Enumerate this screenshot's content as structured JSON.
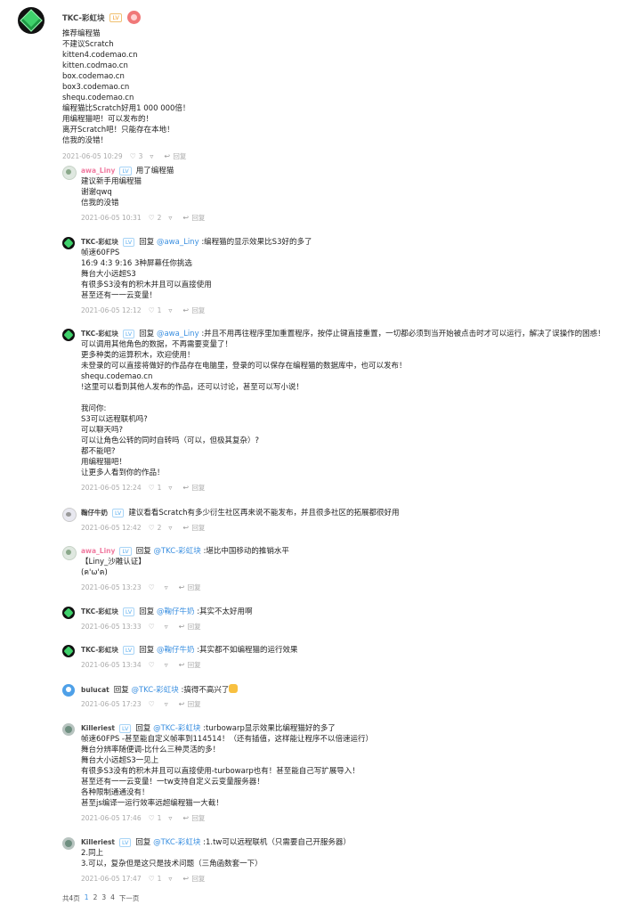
{
  "post": {
    "author": "TKC-彩虹块",
    "badge": "LV",
    "lines": [
      "推荐编程猫",
      "不建议Scratch",
      "kitten4.codemao.cn",
      "kitten.codmao.cn",
      "box.codemao.cn",
      "box3.codemao.cn",
      "shequ.codemao.cn",
      "编程猫比Scratch好用1 000 000倍！",
      "用编程猫吧！可以发布的！",
      "离开Scratch吧！只能存在本地！",
      "信我的没错！"
    ],
    "time": "2021-06-05 10:29",
    "likes": "3",
    "reply_label": "回复"
  },
  "replies": [
    {
      "name": "awa_Liny",
      "name_style": "pink",
      "avatar": "pink",
      "badge": "LV",
      "reply_prefix": "",
      "at": "",
      "head_text": "用了编程猫",
      "lines": [
        "建议新手用编程猫",
        "谢谢qwq",
        "信我的没错"
      ],
      "time": "2021-06-05 10:31",
      "likes": "2"
    },
    {
      "name": "TKC-彩虹块",
      "name_style": "",
      "avatar": "green",
      "badge": "LV",
      "reply_prefix": "回复",
      "at": "@awa_Liny",
      "head_text": ":编程猫的显示效果比S3好的多了",
      "lines": [
        "帧速60FPS",
        "16:9 4:3 9:16 3种屏幕任你挑选",
        "舞台大小远超S3",
        "有很多S3没有的积木并且可以直接使用",
        "甚至还有一一云变量！"
      ],
      "time": "2021-06-05 12:12",
      "likes": "1"
    },
    {
      "name": "TKC-彩虹块",
      "name_style": "",
      "avatar": "green",
      "badge": "LV",
      "reply_prefix": "回复",
      "at": "@awa_Liny",
      "head_text": ":并且不用再往程序里加重置程序，按停止键直接重置，一切都必须到当开始被点击时才可以运行，解决了误操作的困惑！",
      "lines": [
        "可以调用其他角色的数据，不再需要变量了！",
        "更多种类的运算积木，欢迎使用！",
        "未登录的可以直接将做好的作品存在电脑里，登录的可以保存在编程猫的数据库中，也可以发布！",
        "shequ.codemao.cn",
        "!这里可以看到其他人发布的作品，还可以讨论，甚至可以写小说！",
        "",
        "我问你:",
        "S3可以远程联机吗?",
        "可以聊天吗?",
        "可以让角色公转的同时自转吗（可以，但极其复杂）?",
        "都不能吧?",
        "用编程猫吧！",
        "让更多人看到你的作品！"
      ],
      "time": "2021-06-05 12:24",
      "likes": "1"
    },
    {
      "name": "鞠仔牛奶",
      "name_style": "",
      "avatar": "cat",
      "badge": "LV",
      "reply_prefix": "",
      "at": "",
      "head_text": "建议看看Scratch有多少衍生社区再来说不能发布，并且很多社区的拓展都很好用",
      "lines": [],
      "time": "2021-06-05 12:42",
      "likes": "2"
    },
    {
      "name": "awa_Liny",
      "name_style": "pink",
      "avatar": "pink",
      "badge": "LV",
      "reply_prefix": "回复",
      "at": "@TKC-彩虹块",
      "head_text": ":堪比中国移动的推销水平",
      "lines": [
        "【Liny_沙雕认证】",
        "(ฅ'ω'ฅ)"
      ],
      "time": "2021-06-05 13:23",
      "likes": ""
    },
    {
      "name": "TKC-彩虹块",
      "name_style": "",
      "avatar": "green",
      "badge": "LV",
      "reply_prefix": "回复",
      "at": "@鞠仔牛奶",
      "head_text": ":其实不太好用啊",
      "lines": [],
      "time": "2021-06-05 13:33",
      "likes": ""
    },
    {
      "name": "TKC-彩虹块",
      "name_style": "",
      "avatar": "green",
      "badge": "LV",
      "reply_prefix": "回复",
      "at": "@鞠仔牛奶",
      "head_text": ":其实都不如编程猫的运行效果",
      "lines": [],
      "time": "2021-06-05 13:34",
      "likes": ""
    },
    {
      "name": "bulucat",
      "name_style": "",
      "avatar": "blue",
      "badge": "",
      "reply_prefix": "回复",
      "at": "@TKC-彩虹块",
      "head_text": ":搞得不高兴了",
      "lines": [],
      "time": "2021-06-05 17:23",
      "likes": ""
    },
    {
      "name": "Killeriest",
      "name_style": "",
      "avatar": "grey",
      "badge": "LV",
      "reply_prefix": "回复",
      "at": "@TKC-彩虹块",
      "head_text": ":turbowarp显示效果比编程猫好的多了",
      "lines": [
        "帧速60FPS -甚至能自定义帧率到114514！（还有插值，这样能让程序不以倍速运行）",
        "舞台分辨率随便调-比什么三种灵活的多！",
        "舞台大小远超S3一见上",
        "有很多S3没有的积木并且可以直接使用-turbowarp也有！甚至能自己写扩展导入！",
        "甚至还有一一云变量！一tw支持自定义云变量服务器！",
        "各种限制通通没有！",
        "甚至js编译一运行效率远超编程猫一大截！"
      ],
      "time": "2021-06-05 17:46",
      "likes": "1"
    },
    {
      "name": "Killeriest",
      "name_style": "",
      "avatar": "grey",
      "badge": "LV",
      "reply_prefix": "回复",
      "at": "@TKC-彩虹块",
      "head_text": ":1.tw可以远程联机（只需要自己开服务器）",
      "lines": [
        "2.同上",
        "3.可以，复杂但是这只是技术问题（三角函数套一下）"
      ],
      "time": "2021-06-05 17:47",
      "likes": "1"
    }
  ],
  "pager": {
    "total": "共4页",
    "pages": [
      "1",
      "2",
      "3",
      "4"
    ],
    "next": "下一页"
  }
}
